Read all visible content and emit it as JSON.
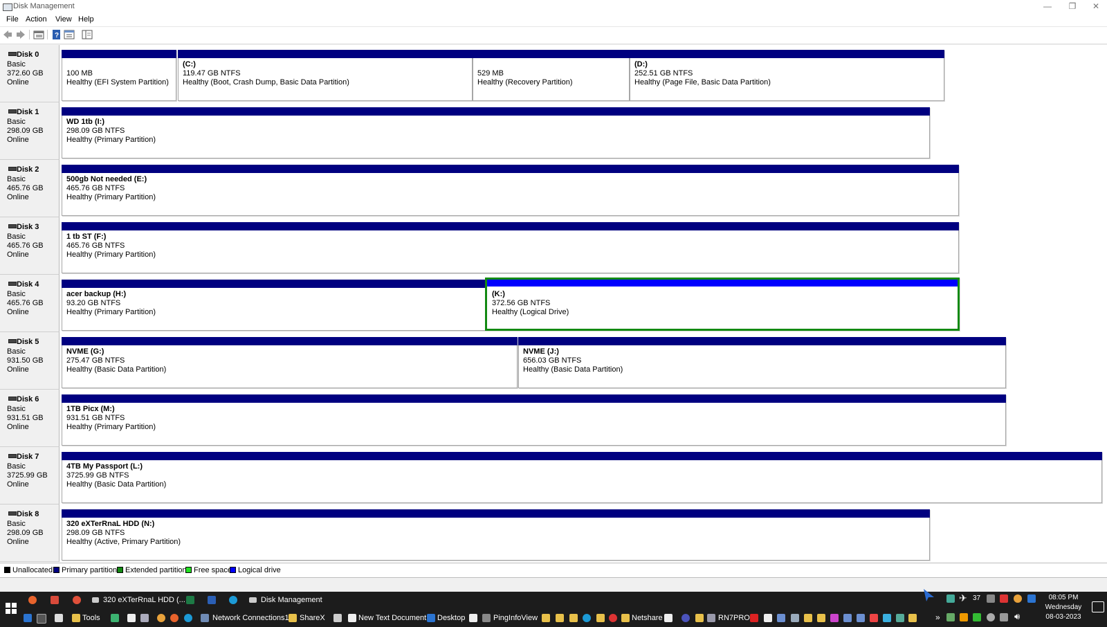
{
  "window": {
    "title": "Disk Management",
    "controls": [
      "—",
      "❐",
      "✕"
    ]
  },
  "menu": [
    "File",
    "Action",
    "View",
    "Help"
  ],
  "toolbar": [
    "back-icon",
    "forward-icon",
    "disk-list-icon",
    "help-icon",
    "properties-icon",
    "console-tree-icon"
  ],
  "disks": [
    {
      "name": "Disk 0",
      "type": "Basic",
      "size": "372.60 GB",
      "status": "Online",
      "partitions": [
        {
          "name": "",
          "size": "100 MB",
          "status": "Healthy (EFI System Partition)",
          "kind": "primary"
        },
        {
          "name": "(C:)",
          "size": "119.47 GB NTFS",
          "status": "Healthy (Boot, Crash Dump, Basic Data Partition)",
          "kind": "primary"
        },
        {
          "name": "",
          "size": "529 MB",
          "status": "Healthy (Recovery Partition)",
          "kind": "primary"
        },
        {
          "name": "(D:)",
          "size": "252.51 GB NTFS",
          "status": "Healthy (Page File, Basic Data Partition)",
          "kind": "primary"
        }
      ]
    },
    {
      "name": "Disk 1",
      "type": "Basic",
      "size": "298.09 GB",
      "status": "Online",
      "partitions": [
        {
          "name": "WD 1tb (I:)",
          "size": "298.09 GB NTFS",
          "status": "Healthy (Primary Partition)",
          "kind": "primary"
        }
      ]
    },
    {
      "name": "Disk 2",
      "type": "Basic",
      "size": "465.76 GB",
      "status": "Online",
      "partitions": [
        {
          "name": "500gb Not needed  (E:)",
          "size": "465.76 GB NTFS",
          "status": "Healthy (Primary Partition)",
          "kind": "primary"
        }
      ]
    },
    {
      "name": "Disk 3",
      "type": "Basic",
      "size": "465.76 GB",
      "status": "Online",
      "partitions": [
        {
          "name": "1 tb ST  (F:)",
          "size": "465.76 GB NTFS",
          "status": "Healthy (Primary Partition)",
          "kind": "primary"
        }
      ]
    },
    {
      "name": "Disk 4",
      "type": "Basic",
      "size": "465.76 GB",
      "status": "Online",
      "partitions": [
        {
          "name": "acer backup  (H:)",
          "size": "93.20 GB NTFS",
          "status": "Healthy (Primary Partition)",
          "kind": "primary"
        },
        {
          "name": "(K:)",
          "size": "372.56 GB NTFS",
          "status": "Healthy (Logical Drive)",
          "kind": "logical"
        }
      ]
    },
    {
      "name": "Disk 5",
      "type": "Basic",
      "size": "931.50 GB",
      "status": "Online",
      "partitions": [
        {
          "name": "NVME  (G:)",
          "size": "275.47 GB NTFS",
          "status": "Healthy (Basic Data Partition)",
          "kind": "primary"
        },
        {
          "name": "NVME  (J:)",
          "size": "656.03 GB NTFS",
          "status": "Healthy (Basic Data Partition)",
          "kind": "primary"
        }
      ]
    },
    {
      "name": "Disk 6",
      "type": "Basic",
      "size": "931.51 GB",
      "status": "Online",
      "partitions": [
        {
          "name": "1TB Picx  (M:)",
          "size": "931.51 GB NTFS",
          "status": "Healthy (Primary Partition)",
          "kind": "primary"
        }
      ]
    },
    {
      "name": "Disk 7",
      "type": "Basic",
      "size": "3725.99 GB",
      "status": "Online",
      "partitions": [
        {
          "name": "4TB My Passport  (L:)",
          "size": "3725.99 GB NTFS",
          "status": "Healthy (Basic Data Partition)",
          "kind": "primary"
        }
      ]
    },
    {
      "name": "Disk 8",
      "type": "Basic",
      "size": "298.09 GB",
      "status": "Online",
      "partitions": [
        {
          "name": "320 eXTerRnaL HDD  (N:)",
          "size": "298.09 GB NTFS",
          "status": "Healthy (Active, Primary Partition)",
          "kind": "primary"
        }
      ]
    }
  ],
  "legend": [
    {
      "label": "Unallocated",
      "color": "#000000"
    },
    {
      "label": "Primary partition",
      "color": "#000080"
    },
    {
      "label": "Extended partition",
      "color": "#138a13"
    },
    {
      "label": "Free space",
      "color": "#22e022"
    },
    {
      "label": "Logical drive",
      "color": "#0000ff"
    }
  ],
  "taskbar": {
    "row1": [
      "320 eXTerRnaL HDD (...",
      "Disk Management"
    ],
    "row2": [
      "Tools",
      "Network Connections1",
      "ShareX",
      "New Text Document",
      "Desktop",
      "PingInfoView",
      "Netshare",
      "RN7PRO"
    ],
    "badge": "37",
    "time": "08:05 PM",
    "day": "Wednesday",
    "date": "08-03-2023"
  }
}
